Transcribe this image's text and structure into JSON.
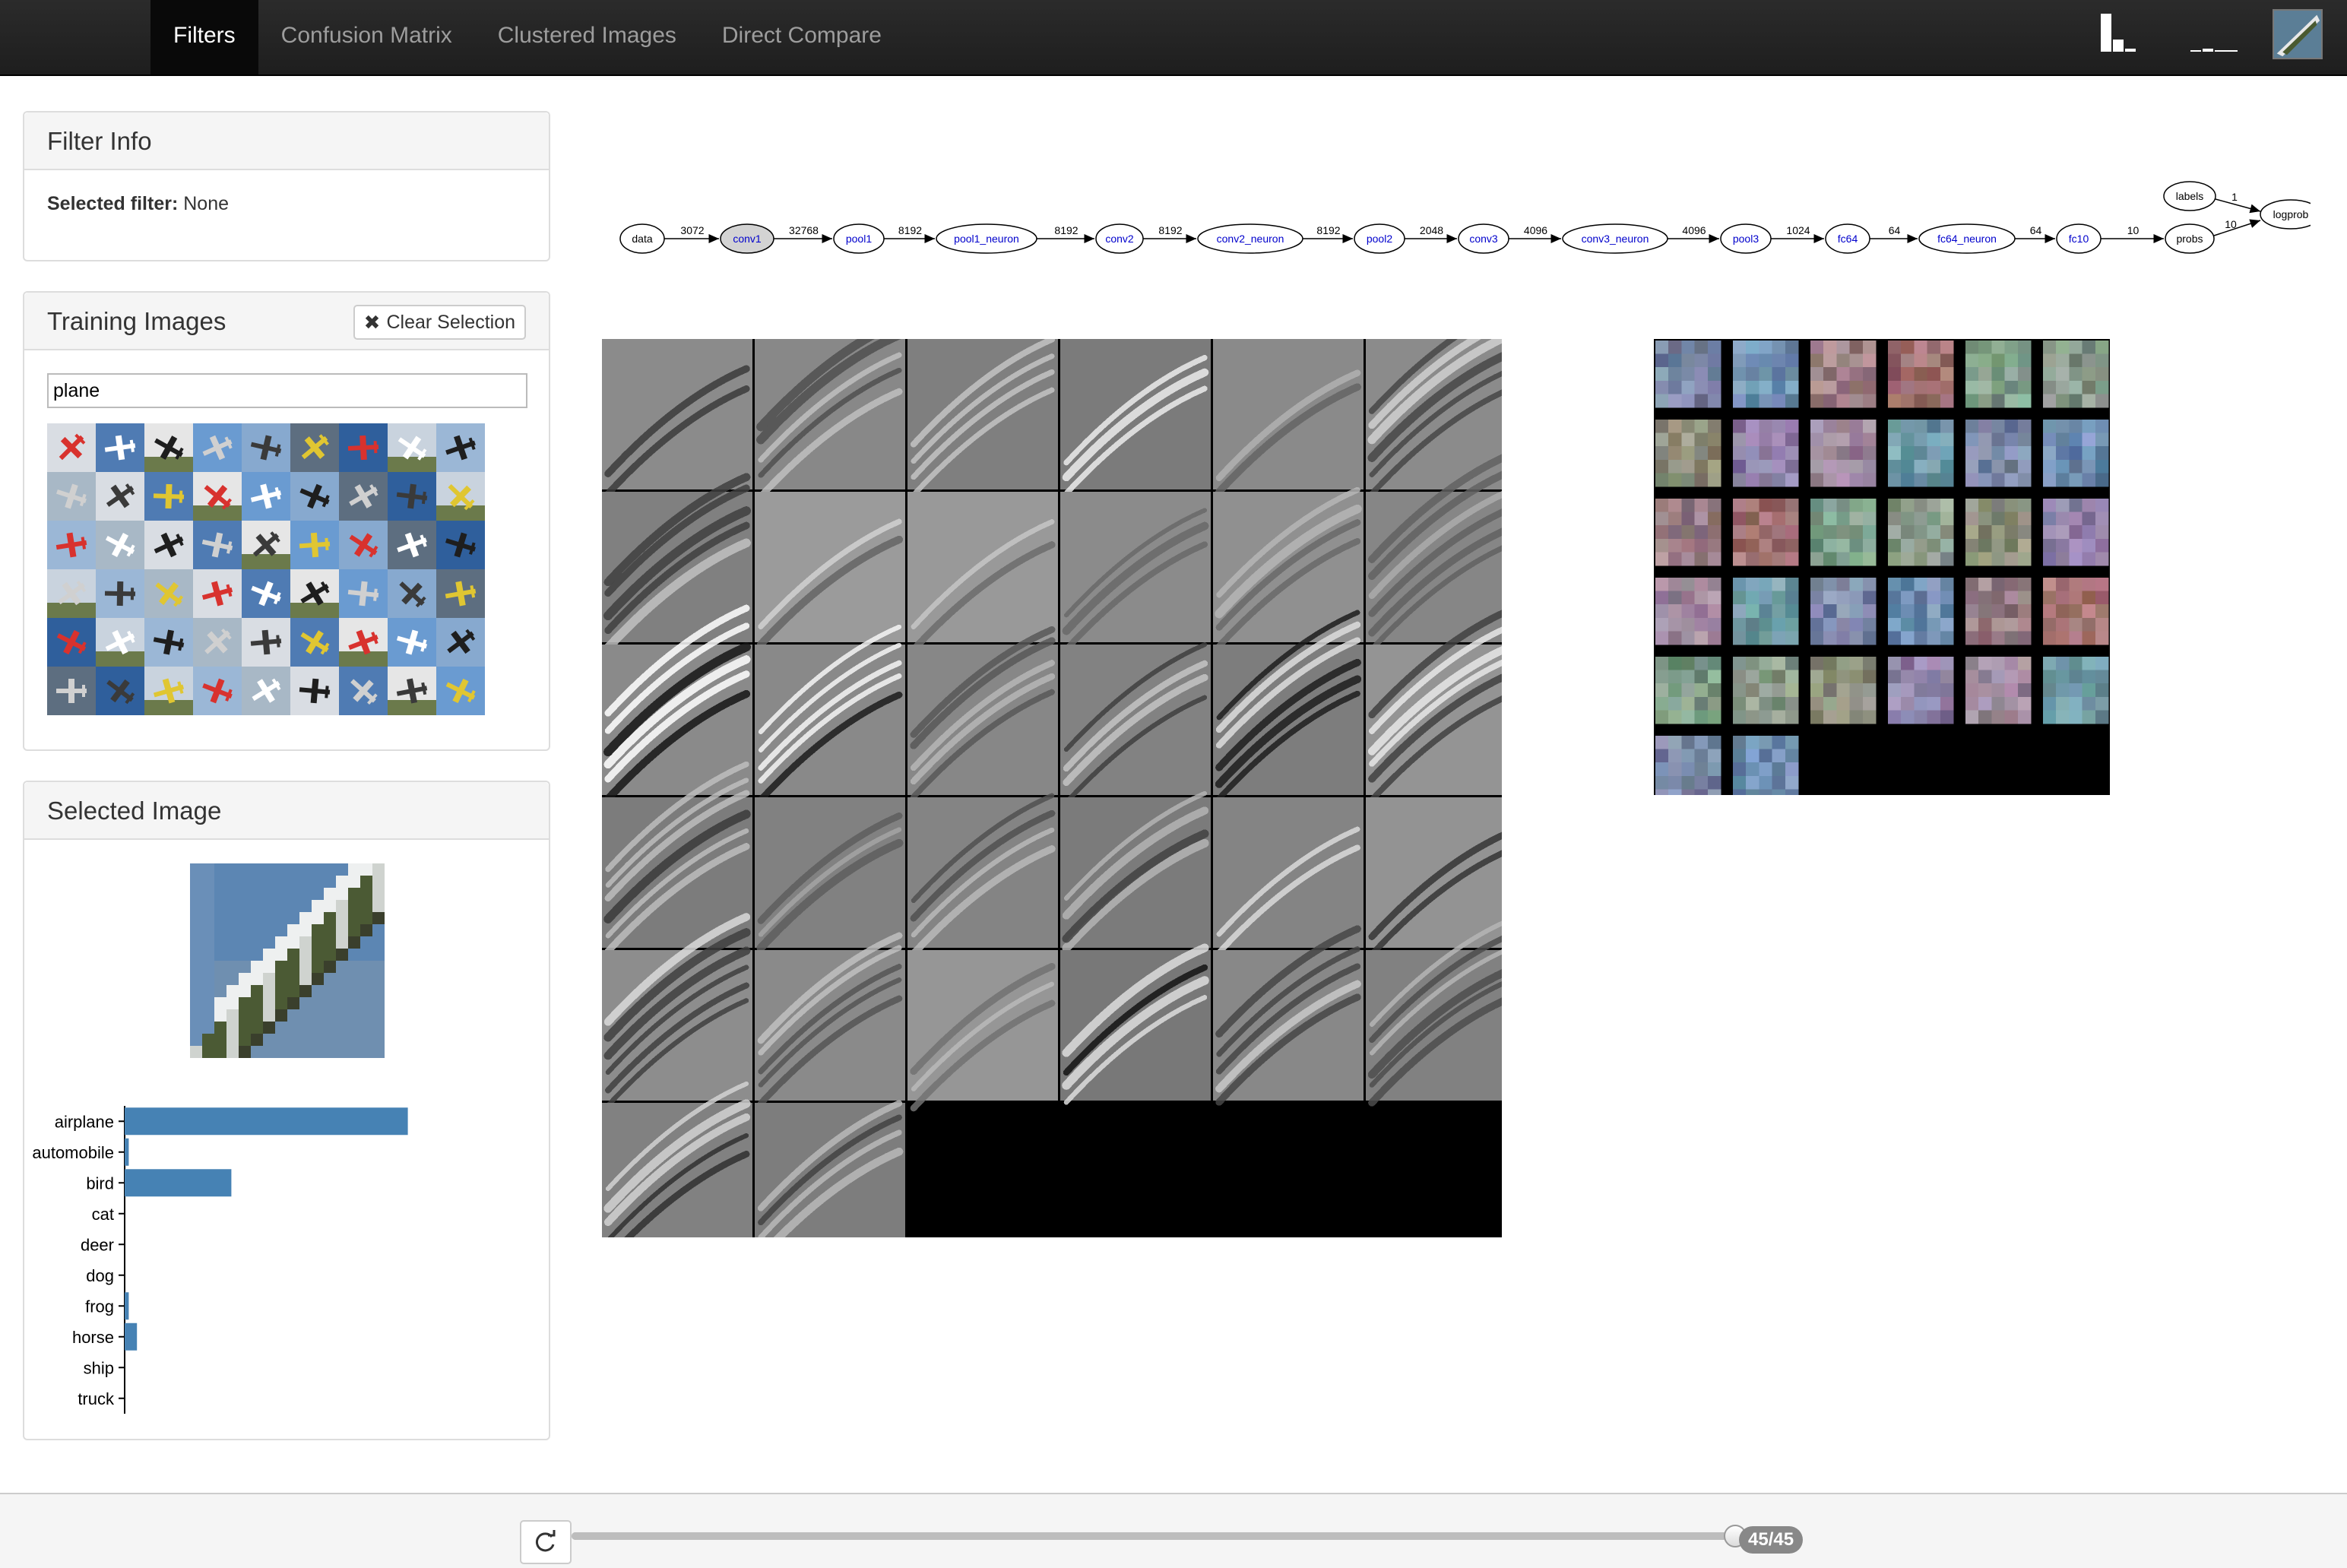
{
  "nav": {
    "tabs": [
      {
        "label": "Filters",
        "active": true
      },
      {
        "label": "Confusion Matrix",
        "active": false
      },
      {
        "label": "Clustered Images",
        "active": false
      },
      {
        "label": "Direct Compare",
        "active": false
      }
    ]
  },
  "filter_info": {
    "title": "Filter Info",
    "selected_label": "Selected filter:",
    "selected_value": "None"
  },
  "training_images": {
    "title": "Training Images",
    "clear_button": "Clear Selection",
    "clear_icon": "close-icon",
    "search_value": "plane"
  },
  "selected_image": {
    "title": "Selected Image"
  },
  "chart_data": {
    "type": "bar",
    "orientation": "horizontal",
    "categories": [
      "airplane",
      "automobile",
      "bird",
      "cat",
      "deer",
      "dog",
      "frog",
      "horse",
      "ship",
      "truck"
    ],
    "values": [
      0.69,
      0.01,
      0.26,
      0.0,
      0.0,
      0.0,
      0.01,
      0.03,
      0.0,
      0.0
    ],
    "xlim": [
      0,
      1
    ],
    "bar_color": "#4682b4"
  },
  "network": {
    "nodes": [
      "data",
      "conv1",
      "pool1",
      "pool1_neuron",
      "conv2",
      "conv2_neuron",
      "pool2",
      "conv3",
      "conv3_neuron",
      "pool3",
      "fc64",
      "fc64_neuron",
      "fc10",
      "probs",
      "labels",
      "logprob"
    ],
    "edge_labels": [
      "3072",
      "32768",
      "8192",
      "8192",
      "8192",
      "8192",
      "2048",
      "4096",
      "4096",
      "1024",
      "64",
      "64",
      "10",
      "10",
      "1"
    ],
    "highlighted_node": "conv1",
    "node_color_default": "#000000",
    "node_color_layer": "#0000cc"
  },
  "filter_grids": {
    "large_count": 32,
    "small_count": 32
  },
  "slider": {
    "current": 45,
    "total": 45,
    "badge": "45/45"
  },
  "colors": {
    "navbar": "#222222",
    "bar": "#4682b4",
    "badge": "#888888"
  }
}
